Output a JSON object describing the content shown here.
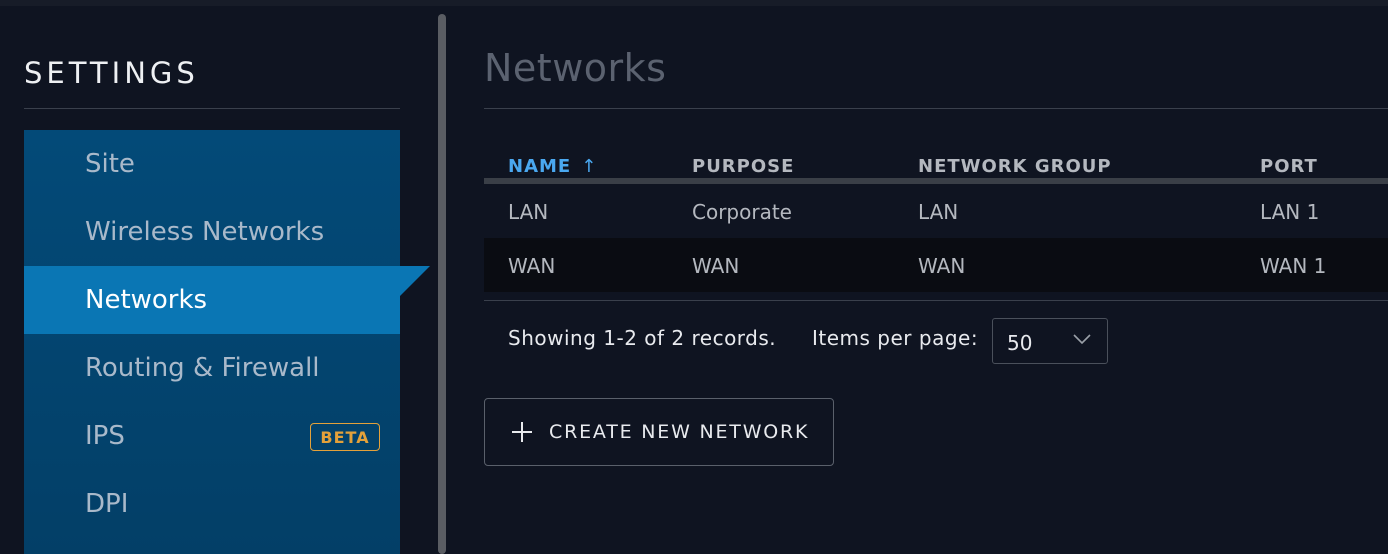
{
  "sidebar": {
    "title": "SETTINGS",
    "items": [
      {
        "label": "Site"
      },
      {
        "label": "Wireless Networks"
      },
      {
        "label": "Networks"
      },
      {
        "label": "Routing & Firewall"
      },
      {
        "label": "IPS",
        "badge": "BETA"
      },
      {
        "label": "DPI"
      }
    ],
    "active_index": 2,
    "colors": {
      "active": "#0a76b4",
      "nav_bg": "#034a78",
      "badge": "#e4a13a"
    }
  },
  "main": {
    "title": "Networks",
    "table": {
      "columns": [
        "NAME",
        "PURPOSE",
        "NETWORK GROUP",
        "PORT"
      ],
      "sort_icon": "↑",
      "rows": [
        [
          "LAN",
          "Corporate",
          "LAN",
          "LAN 1"
        ],
        [
          "WAN",
          "WAN",
          "WAN",
          "WAN 1"
        ]
      ]
    },
    "pager": {
      "summary": "Showing 1-2 of 2 records.",
      "items_label": "Items per page:",
      "items_value": "50"
    },
    "create_button": "CREATE NEW NETWORK",
    "colors": {
      "sort_accent": "#4aa8f0",
      "background": "#0f1421"
    }
  }
}
